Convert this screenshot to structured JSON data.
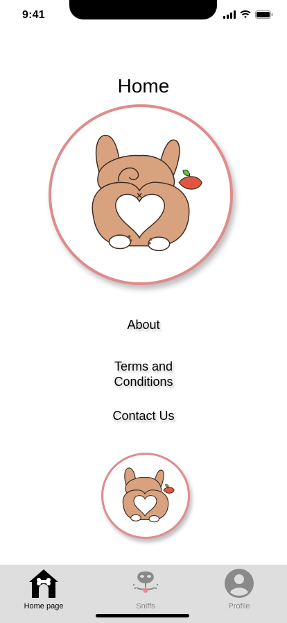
{
  "status_bar": {
    "time": "9:41",
    "icons": [
      "signal-icon",
      "wifi-icon",
      "battery-icon"
    ]
  },
  "page": {
    "title": "Home"
  },
  "menu": {
    "about": "About",
    "terms_line1": "Terms and",
    "terms_line2": "Conditions",
    "contact": "Contact Us"
  },
  "tab_bar": {
    "tabs": [
      {
        "label": "Home page",
        "icon": "doghouse-icon",
        "active": true
      },
      {
        "label": "Sniffs",
        "icon": "dog-nose-icon",
        "active": false
      },
      {
        "label": "Profile",
        "icon": "user-avatar-icon",
        "active": false
      }
    ]
  },
  "colors": {
    "circle_border": "#e08c8c",
    "tab_bar_bg": "#dedede",
    "corgi_fur": "#d9a27e",
    "inactive_tab": "#8a8a8a"
  }
}
